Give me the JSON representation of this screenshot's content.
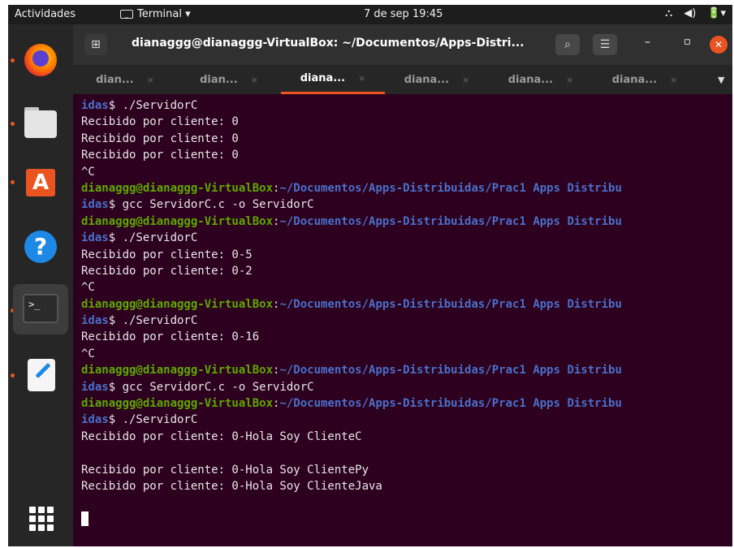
{
  "topbar": {
    "activities": "Actividades",
    "app_menu": "Terminal ▾",
    "clock": "7 de sep  19:45",
    "network": "⛬",
    "volume": "◀)",
    "power": "🔋▾"
  },
  "colors": {
    "terminal_bg": "#2c001e",
    "user_host": "#5fa800",
    "path": "#4b6fc8",
    "accent": "#e95420"
  },
  "dock": {
    "items": [
      "firefox-icon",
      "files-icon",
      "software-icon",
      "help-icon",
      "terminal-icon",
      "text-editor-icon",
      "app-grid-icon"
    ]
  },
  "window": {
    "title": "dianaggg@dianaggg-VirtualBox: ~/Documentos/Apps-Distri...",
    "tabs": [
      {
        "label": "dian...",
        "close": "×"
      },
      {
        "label": "dian...",
        "close": "×"
      },
      {
        "label": "diana...",
        "close": "×"
      },
      {
        "label": "diana...",
        "close": "×"
      },
      {
        "label": "diana...",
        "close": "×"
      },
      {
        "label": "diana...",
        "close": "×"
      }
    ],
    "active_tab": 2
  },
  "terminal": {
    "lines": [
      {
        "path": "idas",
        "text": "$ ./ServidorC"
      },
      {
        "text": "Recibido por cliente: 0"
      },
      {
        "text": "Recibido por cliente: 0"
      },
      {
        "text": "Recibido por cliente: 0"
      },
      {
        "text": "^C"
      },
      {
        "user": "dianaggg@dianaggg-VirtualBox",
        "path": "~/Documentos/Apps-Distribuidas/Prac1 Apps Distribu"
      },
      {
        "path": "idas",
        "text": "$ gcc ServidorC.c -o ServidorC"
      },
      {
        "user": "dianaggg@dianaggg-VirtualBox",
        "path": "~/Documentos/Apps-Distribuidas/Prac1 Apps Distribu"
      },
      {
        "path": "idas",
        "text": "$ ./ServidorC"
      },
      {
        "text": "Recibido por cliente: 0-5"
      },
      {
        "text": "Recibido por cliente: 0-2"
      },
      {
        "text": "^C"
      },
      {
        "user": "dianaggg@dianaggg-VirtualBox",
        "path": "~/Documentos/Apps-Distribuidas/Prac1 Apps Distribu"
      },
      {
        "path": "idas",
        "text": "$ ./ServidorC"
      },
      {
        "text": "Recibido por cliente: 0-16"
      },
      {
        "text": "^C"
      },
      {
        "user": "dianaggg@dianaggg-VirtualBox",
        "path": "~/Documentos/Apps-Distribuidas/Prac1 Apps Distribu"
      },
      {
        "path": "idas",
        "text": "$ gcc ServidorC.c -o ServidorC"
      },
      {
        "user": "dianaggg@dianaggg-VirtualBox",
        "path": "~/Documentos/Apps-Distribuidas/Prac1 Apps Distribu"
      },
      {
        "path": "idas",
        "text": "$ ./ServidorC"
      },
      {
        "text": "Recibido por cliente: 0-Hola Soy ClienteC"
      },
      {
        "text": ""
      },
      {
        "text": "Recibido por cliente: 0-Hola Soy ClientePy"
      },
      {
        "text": "Recibido por cliente: 0-Hola Soy ClienteJava"
      },
      {
        "text": ""
      },
      {
        "cursor": true
      }
    ]
  }
}
